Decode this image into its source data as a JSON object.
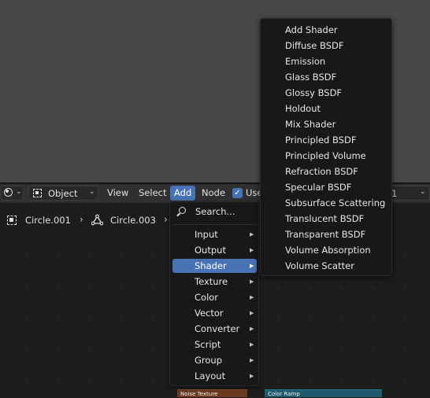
{
  "header": {
    "object_mode": "Object",
    "menus": [
      "View",
      "Select",
      "Add",
      "Node"
    ],
    "use_nodes_label": "Use",
    "right_field_value": "1"
  },
  "breadcrumb": {
    "object": "Circle.001",
    "mesh": "Circle.003"
  },
  "add_menu": {
    "search_label": "Search...",
    "categories": [
      "Input",
      "Output",
      "Shader",
      "Texture",
      "Color",
      "Vector",
      "Converter",
      "Script",
      "Group",
      "Layout"
    ],
    "active_category": "Shader"
  },
  "shader_submenu": {
    "items": [
      "Add Shader",
      "Diffuse BSDF",
      "Emission",
      "Glass BSDF",
      "Glossy BSDF",
      "Holdout",
      "Mix Shader",
      "Principled BSDF",
      "Principled Volume",
      "Refraction BSDF",
      "Specular BSDF",
      "Subsurface Scattering",
      "Translucent BSDF",
      "Transparent BSDF",
      "Volume Absorption",
      "Volume Scatter"
    ]
  },
  "nodes": {
    "noise_texture": "Noise Texture",
    "color_ramp": "Color Ramp"
  },
  "colors": {
    "accent": "#4772b3",
    "menu_bg": "#181818",
    "header_bg": "#303030",
    "viewport_bg": "#484848"
  }
}
